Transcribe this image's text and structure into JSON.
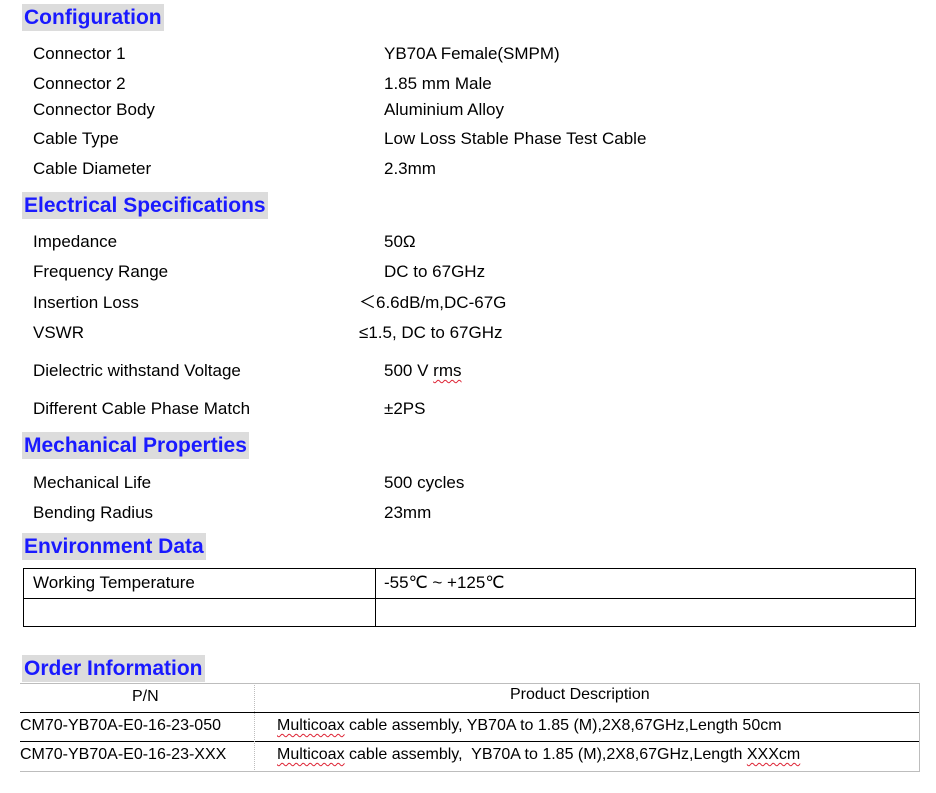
{
  "sections": {
    "configuration": "Configuration",
    "electrical": "Electrical Specifications",
    "mechanical": "Mechanical Properties",
    "environment": "Environment Data",
    "order": "Order Information"
  },
  "configuration": [
    {
      "label": "Connector 1",
      "value": "YB70A Female(SMPM)"
    },
    {
      "label": "Connector 2",
      "value": "1.85 mm Male"
    },
    {
      "label": "Connector Body",
      "value": "Aluminium Alloy"
    },
    {
      "label": "Cable Type",
      "value": "Low Loss Stable Phase Test Cable"
    },
    {
      "label": "Cable Diameter",
      "value": "2.3mm"
    }
  ],
  "electrical": [
    {
      "label": "Impedance",
      "value": "50Ω"
    },
    {
      "label": "Frequency Range",
      "value": "DC to 67GHz"
    },
    {
      "label": "Insertion Loss",
      "value": "＜6.6dB/m,DC-67G"
    },
    {
      "label": "VSWR",
      "value": "≤1.5, DC to 67GHz"
    },
    {
      "label": "Dielectric withstand Voltage",
      "value": "500 V ",
      "value_suffix": "rms"
    },
    {
      "label": "Different Cable Phase Match",
      "value": "±2PS"
    }
  ],
  "mechanical": [
    {
      "label": "Mechanical Life",
      "value": "500 cycles"
    },
    {
      "label": "Bending Radius",
      "value": "23mm"
    }
  ],
  "environment": {
    "label": "Working Temperature",
    "value": "-55℃ ~ +125℃"
  },
  "order": {
    "headers": {
      "pn": "P/N",
      "desc": "Product Description"
    },
    "rows": [
      {
        "pn": "CM70-YB70A-E0-16-23-050",
        "desc_prefix": "Multicoax",
        "desc": " cable assembly, YB70A to 1.85 (M),2X8,67GHz,Length 50cm"
      },
      {
        "pn": "CM70-YB70A-E0-16-23-XXX",
        "desc_prefix": "Multicoax",
        "desc": " cable assembly,  YB70A to 1.85 (M),2X8,67GHz,Length ",
        "desc_suffix": "XXXcm"
      }
    ]
  }
}
